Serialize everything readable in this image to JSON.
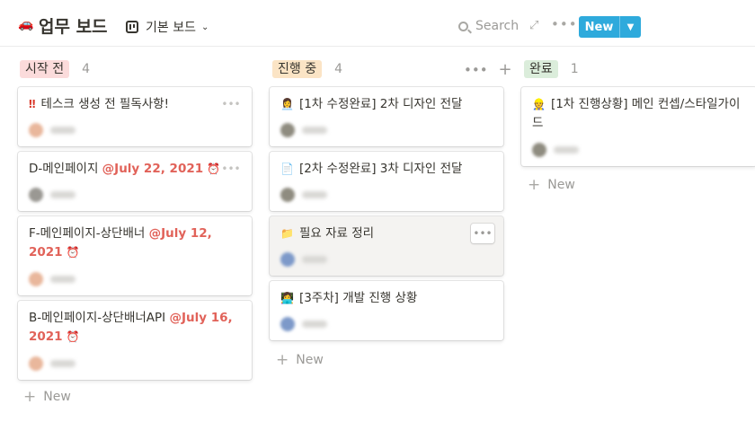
{
  "header": {
    "title": "업무 보드",
    "view_name": "기본 보드",
    "search_label": "Search",
    "new_label": "New",
    "icons": [
      "car-icon",
      "board-view-icon",
      "chevron-down-icon",
      "search-icon",
      "expand-icon",
      "more-icon"
    ]
  },
  "colors": {
    "accent": "#2eaadc",
    "date_red": "#e16259",
    "tag_todo": "#fbdbdb",
    "tag_progress": "#fbe4c5",
    "tag_done": "#dbeddb"
  },
  "columns": [
    {
      "tag": "시작 전",
      "count": "4",
      "add_label": "New",
      "cards": [
        {
          "prefix": "‼",
          "title": "테스크 생성 전 필독사항!",
          "date": ""
        },
        {
          "prefix": "",
          "title": "D-메인페이지",
          "date": "@July 22, 2021"
        },
        {
          "prefix": "",
          "title": "F-메인페이지-상단배너",
          "date": "@July 12, 2021"
        },
        {
          "prefix": "",
          "title": "B-메인페이지-상단배너API",
          "date": "@July 16, 2021"
        }
      ]
    },
    {
      "tag": "진행 중",
      "count": "4",
      "add_label": "New",
      "cards": [
        {
          "prefix": "👩‍💼",
          "title": "[1차 수정완료] 2차 디자인 전달"
        },
        {
          "prefix": "📄",
          "title": "[2차 수정완료] 3차 디자인 전달"
        },
        {
          "prefix": "📁",
          "title": "필요 자료 정리"
        },
        {
          "prefix": "👩‍💻",
          "title": "[3주차] 개발 진행 상황"
        }
      ]
    },
    {
      "tag": "완료",
      "count": "1",
      "add_label": "New",
      "cards": [
        {
          "prefix": "👷",
          "title": "[1차 진행상황] 메인 컨셉/스타일가이드"
        }
      ]
    }
  ]
}
